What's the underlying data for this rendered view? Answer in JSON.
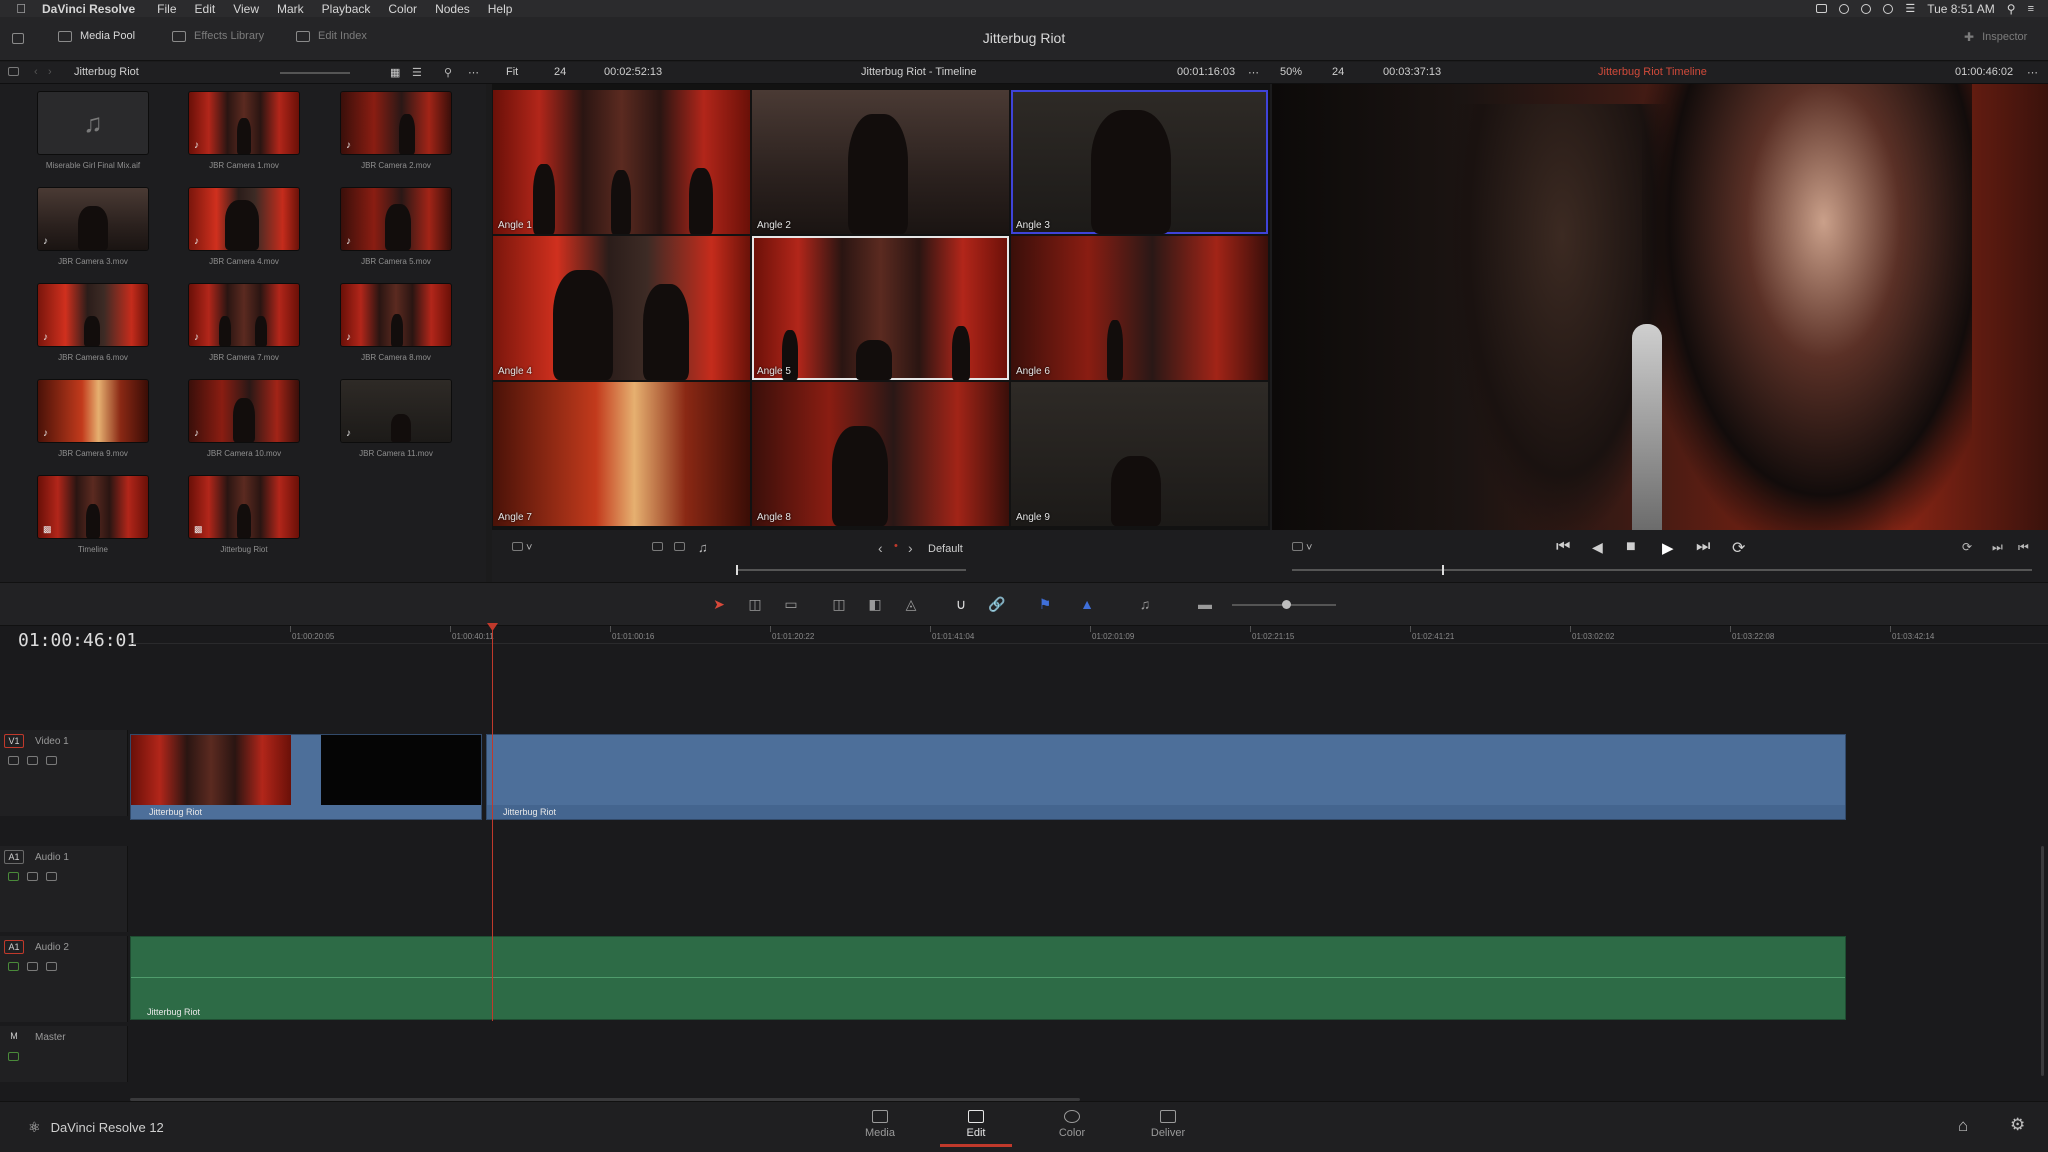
{
  "menubar": {
    "apple": "",
    "app_name": "DaVinci Resolve",
    "menus": [
      "File",
      "Edit",
      "View",
      "Mark",
      "Playback",
      "Color",
      "Nodes",
      "Help"
    ],
    "clock": "Tue 8:51 AM"
  },
  "toolbar": {
    "media_pool": "Media Pool",
    "effects_library": "Effects Library",
    "edit_index": "Edit Index",
    "project_title": "Jitterbug Riot",
    "inspector": "Inspector"
  },
  "subbar": {
    "bin_name": "Jitterbug Riot",
    "fit": "Fit",
    "fps_left": "24",
    "source_duration": "00:02:52:13",
    "source_title": "Jitterbug Riot - Timeline",
    "source_timecode": "00:01:16:03",
    "zoom": "50%",
    "fps_right": "24",
    "timeline_duration": "00:03:37:13",
    "timeline_name": "Jitterbug Riot Timeline",
    "timeline_timecode": "01:00:46:02"
  },
  "media_pool": {
    "clips": [
      {
        "name": "Miserable Girl Final Mix.aif",
        "icon": "music-note-icon"
      },
      {
        "name": "JBR Camera 1.mov"
      },
      {
        "name": "JBR Camera 2.mov"
      },
      {
        "name": "JBR Camera 3.mov"
      },
      {
        "name": "JBR Camera 4.mov"
      },
      {
        "name": "JBR Camera 5.mov"
      },
      {
        "name": "JBR Camera 6.mov"
      },
      {
        "name": "JBR Camera 7.mov"
      },
      {
        "name": "JBR Camera 8.mov"
      },
      {
        "name": "JBR Camera 9.mov"
      },
      {
        "name": "JBR Camera 10.mov"
      },
      {
        "name": "JBR Camera 11.mov"
      },
      {
        "name": "Timeline"
      },
      {
        "name": "Jitterbug Riot"
      }
    ]
  },
  "multicam": {
    "angles": [
      "Angle 1",
      "Angle 2",
      "Angle 3",
      "Angle 4",
      "Angle 5",
      "Angle 6",
      "Angle 7",
      "Angle 8",
      "Angle 9"
    ]
  },
  "viewer_controls": {
    "layout": "Default"
  },
  "timeline": {
    "timecode": "01:00:46:01",
    "ruler": [
      "01:00:20:05",
      "01:00:40:11",
      "01:01:00:16",
      "01:01:20:22",
      "01:01:41:04",
      "01:02:01:09",
      "01:02:21:15",
      "01:02:41:21",
      "01:03:02:02",
      "01:03:22:08",
      "01:03:42:14"
    ],
    "tracks": {
      "v1": {
        "id": "V1",
        "name": "Video 1"
      },
      "a1": {
        "id": "A1",
        "name": "Audio 1"
      },
      "a2": {
        "id": "A1",
        "name": "Audio 2"
      },
      "master": {
        "id": "M",
        "name": "Master"
      }
    },
    "clip_labels": {
      "video_left": "Jitterbug Riot",
      "video_right": "Jitterbug Riot",
      "audio": "Jitterbug Riot"
    }
  },
  "footer": {
    "app_version": "DaVinci Resolve 12",
    "pages": [
      "Media",
      "Edit",
      "Color",
      "Deliver"
    ],
    "active_page": "Edit"
  },
  "colors": {
    "accent_red": "#c0392b",
    "video_clip": "#4d6f9a",
    "audio_clip": "#2d6b46",
    "angle_highlight": "#3f43d9"
  }
}
